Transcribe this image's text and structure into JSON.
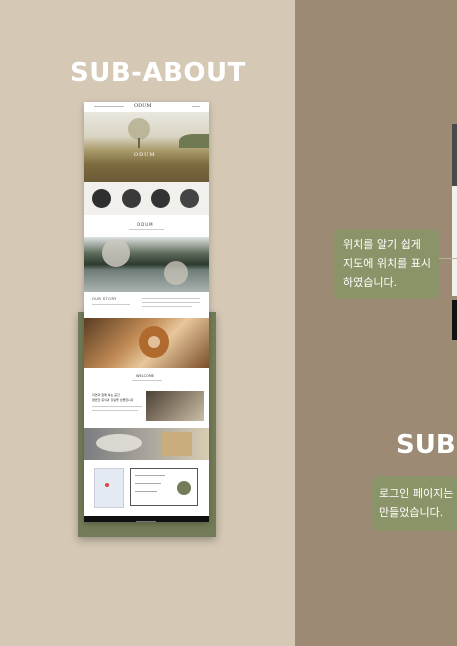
{
  "left_section": {
    "title": "SUB-ABOUT"
  },
  "right_section": {
    "title": "SUB-"
  },
  "callouts": {
    "map_lines": [
      "위치를 알기 쉽게",
      "지도에 위치를 표시",
      "하였습니다."
    ],
    "login_lines": [
      "로그인 페이지는",
      "만들었습니다."
    ]
  },
  "mockup": {
    "logo": "ODUM",
    "hero_text": "ODUM",
    "section_heading": "ODUM",
    "story_heading": "OUR STORY",
    "welcome_heading": "WELCOME",
    "korean_heading_1": "자연과 함께 하는 공간",
    "korean_heading_2": "편안한 휴식과 힐링을 선물합니다"
  },
  "colors": {
    "left_bg": "#d5c9b5",
    "right_bg": "#9c8a74",
    "accent_green": "#8b9468",
    "frame_green": "#737c58"
  }
}
